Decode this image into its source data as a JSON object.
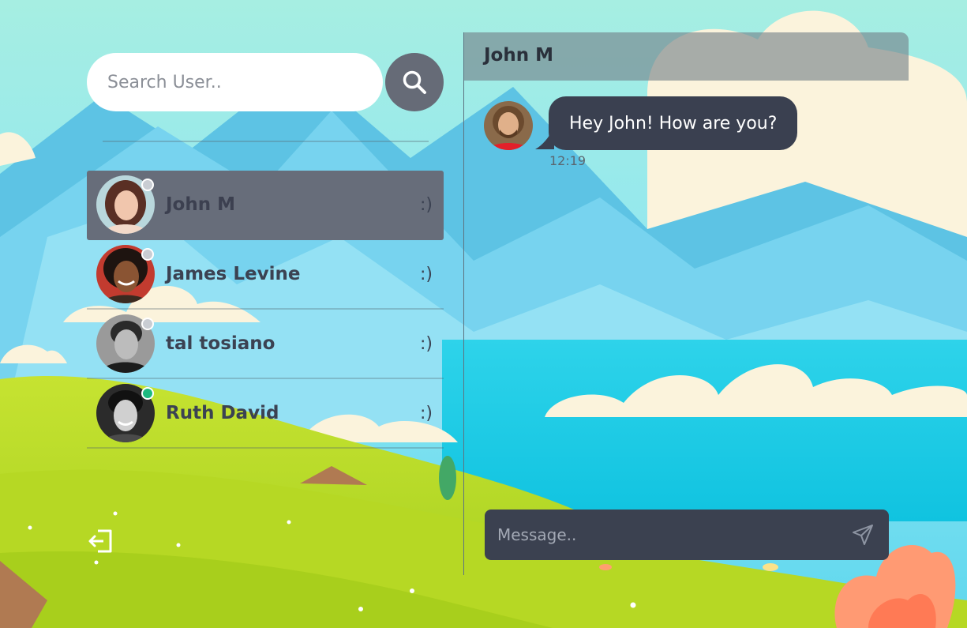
{
  "search": {
    "placeholder": "Search User..",
    "button_icon": "search-icon"
  },
  "users": [
    {
      "name": "John M",
      "status_text": ":)",
      "presence": "offline",
      "active": true
    },
    {
      "name": "James Levine",
      "status_text": ":)",
      "presence": "offline",
      "active": false
    },
    {
      "name": "tal tosiano",
      "status_text": ":)",
      "presence": "offline",
      "active": false
    },
    {
      "name": "Ruth David",
      "status_text": ":)",
      "presence": "online",
      "active": false
    }
  ],
  "sidebar": {
    "logout_icon": "logout-icon"
  },
  "chat": {
    "title": "John M",
    "messages": [
      {
        "text": "Hey John! How are you?",
        "time": "12:19"
      }
    ],
    "composer": {
      "placeholder": "Message..",
      "send_icon": "send-icon"
    }
  },
  "colors": {
    "active_row": "#676d7a",
    "bubble": "#3a4050",
    "online": "#1eb980",
    "offline": "#c9cdd3"
  }
}
